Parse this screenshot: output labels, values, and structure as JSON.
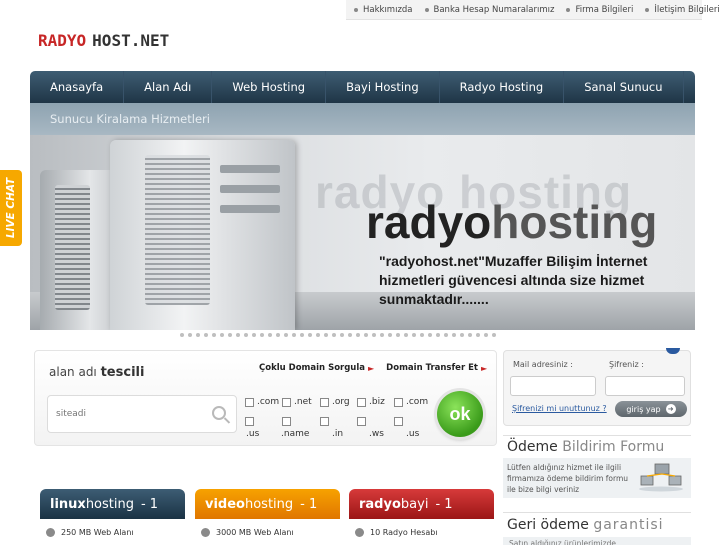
{
  "toplinks": [
    "Hakkımızda",
    "Banka Hesap Numaralarımız",
    "Firma Bilgileri",
    "İletişim Bilgileri"
  ],
  "logo": {
    "part1": "RADYO",
    "part2": "HOST.NET"
  },
  "nav": {
    "items": [
      "Anasayfa",
      "Alan Adı",
      "Web Hosting",
      "Bayi Hosting",
      "Radyo Hosting",
      "Sanal Sunucu"
    ],
    "sub_item": "Sunucu Kiralama Hizmetleri"
  },
  "banner": {
    "bg_text": "radyo hosting",
    "brand_bold": "radyo",
    "brand_light": "hosting",
    "description": "\"radyohost.net\"Muzaffer Bilişim İnternet hizmetleri güvencesi altında size hizmet sunmaktadır......."
  },
  "livechat": {
    "label": "LIVE CHAT"
  },
  "domain": {
    "title_light": "alan adı",
    "title_bold": "tescili",
    "link_bulk": "Çoklu Domain Sorgula",
    "link_transfer": "Domain Transfer Et",
    "search_placeholder": "siteadi",
    "extensions": [
      ".com",
      ".net",
      ".org",
      ".biz",
      ".com",
      ".us",
      ".name",
      ".in",
      ".ws",
      ".us"
    ],
    "ok_label": "ok"
  },
  "login": {
    "email_label": "Mail adresiniz :",
    "password_label": "Şifreniz :",
    "forgot_link": "Şifrenizi mi unuttunuz ?",
    "login_button": "giriş yap"
  },
  "payment": {
    "title_dark": "Ödeme",
    "title_light": "Bildirim Formu",
    "description": "Lütfen aldığınız hizmet ile ilgili firmamıza ödeme bildirim formu ile bize bilgi veriniz"
  },
  "refund": {
    "title_dark": "Geri ödeme",
    "title_light": "garantisi",
    "description": "Satın aldığınız ürünlerimizde"
  },
  "panels": [
    {
      "name_bold": "linux",
      "name_rest": "hosting",
      "num": "- 1",
      "feature": "250 MB Web Alanı"
    },
    {
      "name_bold": "video",
      "name_rest": "hosting",
      "num": "- 1",
      "feature": "3000 MB Web Alanı"
    },
    {
      "name_bold": "radyo",
      "name_rest": "bayi",
      "num": "- 1",
      "feature": "10 Radyo Hesabı"
    }
  ],
  "colors": {
    "nav": "#2b475c",
    "accent_red": "#c72626",
    "livechat": "#f6a800",
    "ok_green": "#4cb32a"
  }
}
